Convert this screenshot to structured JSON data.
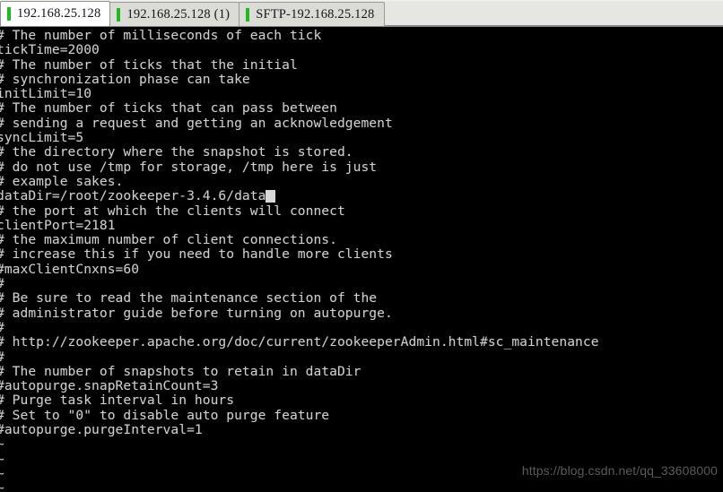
{
  "window": {
    "title": "192.168.25.128",
    "colors": {
      "tab_indicator_green": "#22b81f",
      "terminal_background": "#000000",
      "terminal_text": "#cfcfcf",
      "tabbar_background": "#e6e6e2",
      "active_tab_background": "#ffffff",
      "inactive_tab_background": "#dcdcd7",
      "cursor": "#d8d8d8",
      "watermark": "#5a5a5a"
    }
  },
  "tabbar": {
    "tabs": [
      {
        "label": "192.168.25.128",
        "active": true,
        "indicator": "green-status-bar"
      },
      {
        "label": "192.168.25.128 (1)",
        "active": false,
        "indicator": "green-status-bar"
      },
      {
        "label": "SFTP-192.168.25.128",
        "active": false,
        "indicator": "green-status-bar"
      }
    ]
  },
  "terminal": {
    "editor": "vi",
    "file_hint": "zoo.cfg",
    "cursor_line_index": 9,
    "cursor_after_text": "dataDir=/root/zookeeper-3.4.6/data",
    "lines": [
      "# The number of milliseconds of each tick",
      "tickTime=2000",
      "# The number of ticks that the initial",
      "# synchronization phase can take",
      "initLimit=10",
      "# The number of ticks that can pass between",
      "# sending a request and getting an acknowledgement",
      "syncLimit=5",
      "# the directory where the snapshot is stored.",
      "# do not use /tmp for storage, /tmp here is just",
      "# example sakes.",
      "dataDir=/root/zookeeper-3.4.6/data",
      "# the port at which the clients will connect",
      "clientPort=2181",
      "# the maximum number of client connections.",
      "# increase this if you need to handle more clients",
      "#maxClientCnxns=60",
      "#",
      "# Be sure to read the maintenance section of the",
      "# administrator guide before turning on autopurge.",
      "#",
      "# http://zookeeper.apache.org/doc/current/zookeeperAdmin.html#sc_maintenance",
      "#",
      "# The number of snapshots to retain in dataDir",
      "#autopurge.snapRetainCount=3",
      "# Purge task interval in hours",
      "# Set to \"0\" to disable auto purge feature",
      "#autopurge.purgeInterval=1"
    ],
    "empty_line_marker": "~",
    "empty_line_count": 4
  },
  "watermark": {
    "text": "https://blog.csdn.net/qq_33608000"
  }
}
